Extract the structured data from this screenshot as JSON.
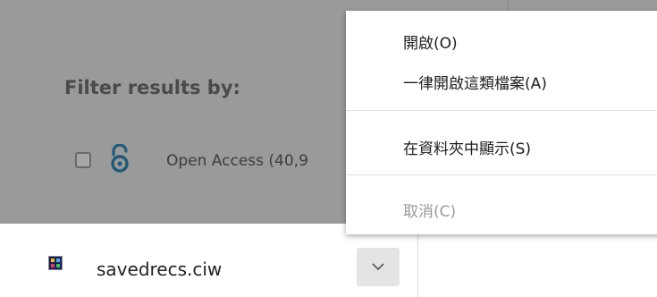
{
  "filter": {
    "title": "Filter results by:",
    "open_access_label": "Open Access (40,9"
  },
  "download": {
    "file_name": "savedrecs.ciw",
    "dropdown_icon": "chevron-down-icon"
  },
  "context_menu": {
    "items": [
      {
        "label": "開啟(O)",
        "enabled": true
      },
      {
        "label": "一律開啟這類檔案(A)",
        "enabled": true
      },
      {
        "label": "在資料夾中顯示(S)",
        "enabled": true
      },
      {
        "label": "取消(C)",
        "enabled": false
      }
    ]
  },
  "colors": {
    "overlay": "#9a9a9a",
    "oa_icon": "#1f5a79",
    "disabled_text": "#9a9a9a"
  }
}
